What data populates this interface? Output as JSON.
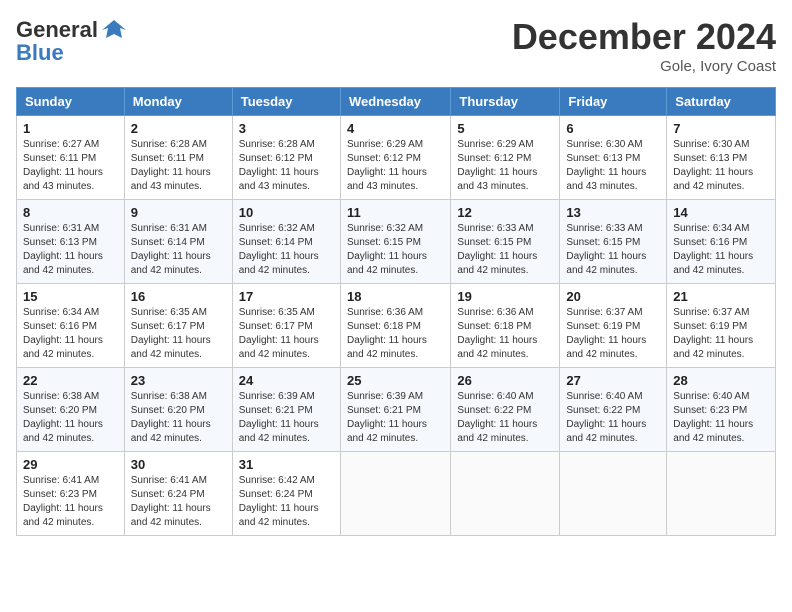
{
  "header": {
    "logo_line1": "General",
    "logo_line2": "Blue",
    "month_year": "December 2024",
    "location": "Gole, Ivory Coast"
  },
  "weekdays": [
    "Sunday",
    "Monday",
    "Tuesday",
    "Wednesday",
    "Thursday",
    "Friday",
    "Saturday"
  ],
  "weeks": [
    [
      {
        "day": "1",
        "sunrise": "6:27 AM",
        "sunset": "6:11 PM",
        "daylight": "11 hours and 43 minutes."
      },
      {
        "day": "2",
        "sunrise": "6:28 AM",
        "sunset": "6:11 PM",
        "daylight": "11 hours and 43 minutes."
      },
      {
        "day": "3",
        "sunrise": "6:28 AM",
        "sunset": "6:12 PM",
        "daylight": "11 hours and 43 minutes."
      },
      {
        "day": "4",
        "sunrise": "6:29 AM",
        "sunset": "6:12 PM",
        "daylight": "11 hours and 43 minutes."
      },
      {
        "day": "5",
        "sunrise": "6:29 AM",
        "sunset": "6:12 PM",
        "daylight": "11 hours and 43 minutes."
      },
      {
        "day": "6",
        "sunrise": "6:30 AM",
        "sunset": "6:13 PM",
        "daylight": "11 hours and 43 minutes."
      },
      {
        "day": "7",
        "sunrise": "6:30 AM",
        "sunset": "6:13 PM",
        "daylight": "11 hours and 42 minutes."
      }
    ],
    [
      {
        "day": "8",
        "sunrise": "6:31 AM",
        "sunset": "6:13 PM",
        "daylight": "11 hours and 42 minutes."
      },
      {
        "day": "9",
        "sunrise": "6:31 AM",
        "sunset": "6:14 PM",
        "daylight": "11 hours and 42 minutes."
      },
      {
        "day": "10",
        "sunrise": "6:32 AM",
        "sunset": "6:14 PM",
        "daylight": "11 hours and 42 minutes."
      },
      {
        "day": "11",
        "sunrise": "6:32 AM",
        "sunset": "6:15 PM",
        "daylight": "11 hours and 42 minutes."
      },
      {
        "day": "12",
        "sunrise": "6:33 AM",
        "sunset": "6:15 PM",
        "daylight": "11 hours and 42 minutes."
      },
      {
        "day": "13",
        "sunrise": "6:33 AM",
        "sunset": "6:15 PM",
        "daylight": "11 hours and 42 minutes."
      },
      {
        "day": "14",
        "sunrise": "6:34 AM",
        "sunset": "6:16 PM",
        "daylight": "11 hours and 42 minutes."
      }
    ],
    [
      {
        "day": "15",
        "sunrise": "6:34 AM",
        "sunset": "6:16 PM",
        "daylight": "11 hours and 42 minutes."
      },
      {
        "day": "16",
        "sunrise": "6:35 AM",
        "sunset": "6:17 PM",
        "daylight": "11 hours and 42 minutes."
      },
      {
        "day": "17",
        "sunrise": "6:35 AM",
        "sunset": "6:17 PM",
        "daylight": "11 hours and 42 minutes."
      },
      {
        "day": "18",
        "sunrise": "6:36 AM",
        "sunset": "6:18 PM",
        "daylight": "11 hours and 42 minutes."
      },
      {
        "day": "19",
        "sunrise": "6:36 AM",
        "sunset": "6:18 PM",
        "daylight": "11 hours and 42 minutes."
      },
      {
        "day": "20",
        "sunrise": "6:37 AM",
        "sunset": "6:19 PM",
        "daylight": "11 hours and 42 minutes."
      },
      {
        "day": "21",
        "sunrise": "6:37 AM",
        "sunset": "6:19 PM",
        "daylight": "11 hours and 42 minutes."
      }
    ],
    [
      {
        "day": "22",
        "sunrise": "6:38 AM",
        "sunset": "6:20 PM",
        "daylight": "11 hours and 42 minutes."
      },
      {
        "day": "23",
        "sunrise": "6:38 AM",
        "sunset": "6:20 PM",
        "daylight": "11 hours and 42 minutes."
      },
      {
        "day": "24",
        "sunrise": "6:39 AM",
        "sunset": "6:21 PM",
        "daylight": "11 hours and 42 minutes."
      },
      {
        "day": "25",
        "sunrise": "6:39 AM",
        "sunset": "6:21 PM",
        "daylight": "11 hours and 42 minutes."
      },
      {
        "day": "26",
        "sunrise": "6:40 AM",
        "sunset": "6:22 PM",
        "daylight": "11 hours and 42 minutes."
      },
      {
        "day": "27",
        "sunrise": "6:40 AM",
        "sunset": "6:22 PM",
        "daylight": "11 hours and 42 minutes."
      },
      {
        "day": "28",
        "sunrise": "6:40 AM",
        "sunset": "6:23 PM",
        "daylight": "11 hours and 42 minutes."
      }
    ],
    [
      {
        "day": "29",
        "sunrise": "6:41 AM",
        "sunset": "6:23 PM",
        "daylight": "11 hours and 42 minutes."
      },
      {
        "day": "30",
        "sunrise": "6:41 AM",
        "sunset": "6:24 PM",
        "daylight": "11 hours and 42 minutes."
      },
      {
        "day": "31",
        "sunrise": "6:42 AM",
        "sunset": "6:24 PM",
        "daylight": "11 hours and 42 minutes."
      },
      null,
      null,
      null,
      null
    ]
  ]
}
